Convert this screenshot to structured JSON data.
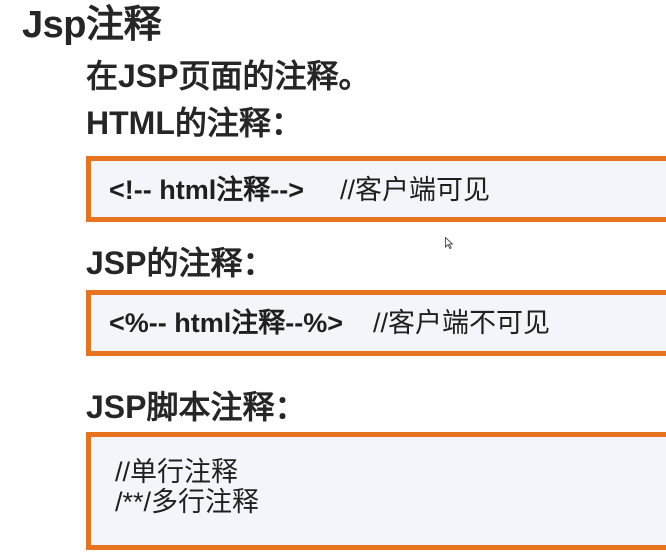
{
  "title": "Jsp注释",
  "intro": "在JSP页面的注释。",
  "html_section": {
    "heading": "HTML的注释：",
    "code": "<!-- html注释-->",
    "comment": "//客户端可见"
  },
  "jsp_section": {
    "heading": "JSP的注释：",
    "code": "<%-- html注释--%>",
    "comment": "//客户端不可见"
  },
  "script_section": {
    "heading": "JSP脚本注释：",
    "line1": "//单行注释",
    "line2": "/**/多行注释"
  },
  "colors": {
    "box_border": "#e8731f",
    "box_background": "#f2f5fa"
  }
}
